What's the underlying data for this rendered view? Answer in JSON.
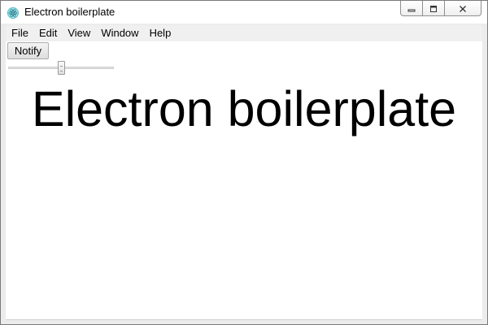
{
  "window": {
    "title": "Electron boilerplate",
    "icon": "electron-logo-icon"
  },
  "controls": {
    "minimize_icon": "minimize-icon",
    "maximize_icon": "maximize-icon",
    "close_icon": "close-icon"
  },
  "menu": {
    "items": [
      {
        "label": "File"
      },
      {
        "label": "Edit"
      },
      {
        "label": "View"
      },
      {
        "label": "Window"
      },
      {
        "label": "Help"
      }
    ]
  },
  "content": {
    "notify_label": "Notify",
    "slider_value_fraction": 0.5,
    "heading": "Electron boilerplate"
  }
}
